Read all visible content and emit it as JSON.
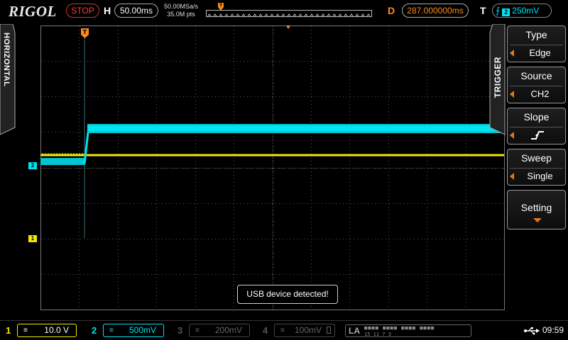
{
  "top": {
    "brand": "RIGOL",
    "run_state": "STOP",
    "h_label": "H",
    "timebase": "50.00ms",
    "sample_rate": "50.00MSa/s",
    "memory_depth": "35.0M pts",
    "d_label": "D",
    "delay": "287.000000ms",
    "t_label": "T",
    "trigger_channel": "2",
    "trigger_level": "250mV"
  },
  "left_tab": {
    "label": "HORIZONTAL"
  },
  "markers": {
    "ch2": "2",
    "ch1": "1",
    "trigger": "T"
  },
  "toast": {
    "message": "USB device detected!"
  },
  "trigger_menu": {
    "tab_label": "TRIGGER",
    "items": [
      {
        "title": "Type",
        "value": "Edge"
      },
      {
        "title": "Source",
        "value": "CH2"
      },
      {
        "title": "Slope",
        "value": "rising-edge"
      },
      {
        "title": "Sweep",
        "value": "Single"
      },
      {
        "title": "Setting",
        "value": ""
      }
    ]
  },
  "bottom": {
    "ch1": {
      "num": "1",
      "coupling": "≡",
      "scale": "10.0 V"
    },
    "ch2": {
      "num": "2",
      "coupling": "≡",
      "scale": "500mV"
    },
    "ch3": {
      "num": "3",
      "coupling": "≡",
      "scale": "200mV"
    },
    "ch4": {
      "num": "4",
      "coupling": "≡",
      "scale": "100mV"
    },
    "la": {
      "label": "LA",
      "dots": "■■■■ ■■■■ ■■■■ ■■■■",
      "nums": "15       11       7       3"
    },
    "time": "09:59"
  },
  "colors": {
    "ch1": "#f2e800",
    "ch2": "#00e5f0",
    "accent": "#ff8a1c",
    "stop": "#ff3b3b"
  }
}
